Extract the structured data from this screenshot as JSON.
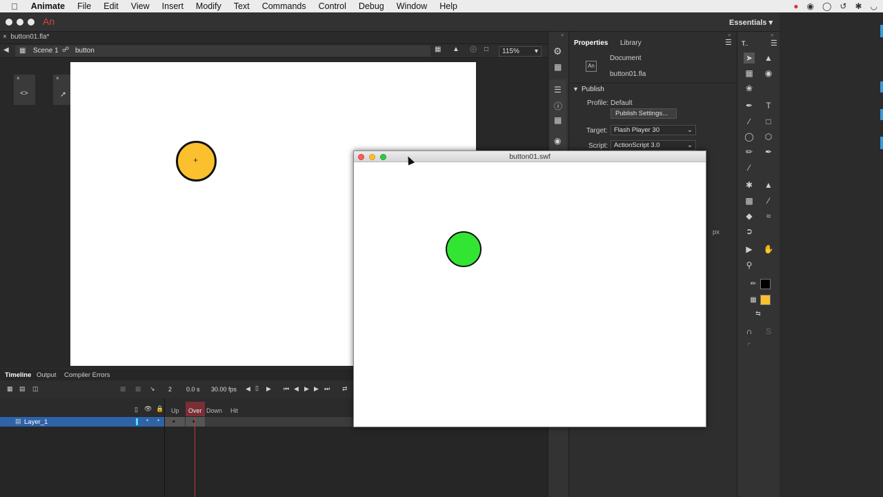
{
  "menubar": {
    "app_name": "Animate",
    "items": [
      "File",
      "Edit",
      "View",
      "Insert",
      "Modify",
      "Text",
      "Commands",
      "Control",
      "Debug",
      "Window",
      "Help"
    ]
  },
  "app": {
    "logo": "An",
    "workspace": "Essentials"
  },
  "document": {
    "tab": "button01.fla*"
  },
  "editbar": {
    "scene": "Scene 1",
    "symbol": "button",
    "zoom": "115%"
  },
  "stage": {
    "button_color": "#fbc02d"
  },
  "swf_window": {
    "title": "button01.swf",
    "button_color": "#33e533"
  },
  "timeline": {
    "tabs": [
      "Timeline",
      "Output",
      "Compiler Errors"
    ],
    "frame": "2",
    "time": "0.0 s",
    "fps": "30.00 fps",
    "frame_labels": [
      "Up",
      "Over",
      "Down",
      "Hit"
    ],
    "layer_name": "Layer_1"
  },
  "properties": {
    "tabs": [
      "Properties",
      "Library"
    ],
    "doc_icon": "An",
    "doc_type": "Document",
    "doc_name": "button01.fla",
    "section": "Publish",
    "profile_label": "Profile:",
    "profile_value": "Default",
    "publish_settings": "Publish Settings...",
    "target_label": "Target:",
    "target_value": "Flash Player 30",
    "script_label": "Script:",
    "script_value": "ActionScript 3.0",
    "unit": "px"
  }
}
